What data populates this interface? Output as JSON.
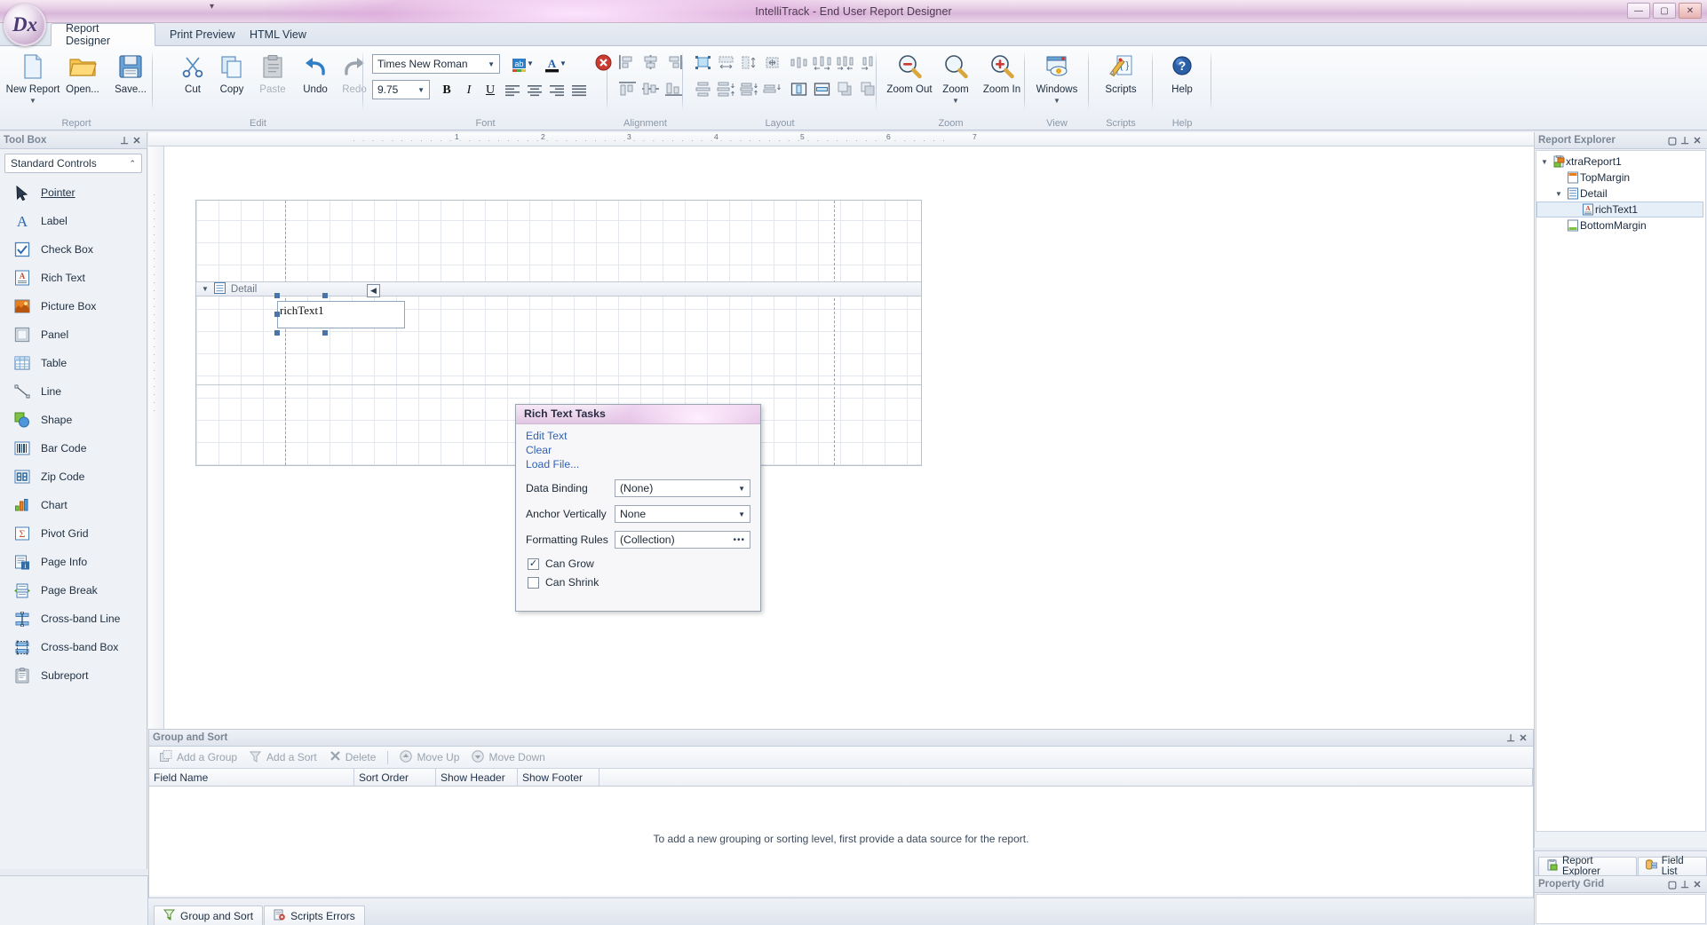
{
  "window": {
    "title": "IntelliTrack - End User Report Designer",
    "minimize_label": "—",
    "maximize_label": "▢",
    "close_label": "✕",
    "orb_label": "Dx",
    "quick_access_caret": "▾"
  },
  "ribbon": {
    "tabs": [
      {
        "label": "Report Designer",
        "active": true
      },
      {
        "label": "Print Preview",
        "active": false
      },
      {
        "label": "HTML View",
        "active": false
      }
    ],
    "groups": [
      {
        "label": "Report"
      },
      {
        "label": "Edit"
      },
      {
        "label": "Font"
      },
      {
        "label": "Alignment"
      },
      {
        "label": "Layout"
      },
      {
        "label": "Zoom"
      },
      {
        "label": "View"
      },
      {
        "label": "Scripts"
      },
      {
        "label": "Help"
      }
    ],
    "report_buttons": [
      {
        "label": "New Report",
        "icon": "new-document-icon",
        "has_dropdown": true,
        "disabled": false
      },
      {
        "label": "Open...",
        "icon": "open-folder-icon",
        "has_dropdown": false,
        "disabled": false
      },
      {
        "label": "Save...",
        "icon": "save-disk-icon",
        "has_dropdown": false,
        "disabled": false
      }
    ],
    "edit_buttons": [
      {
        "label": "Cut",
        "icon": "scissors-icon",
        "disabled": false
      },
      {
        "label": "Copy",
        "icon": "copy-icon",
        "disabled": false
      },
      {
        "label": "Paste",
        "icon": "clipboard-icon",
        "disabled": true
      },
      {
        "label": "Undo",
        "icon": "undo-arrow-icon",
        "disabled": false
      },
      {
        "label": "Redo",
        "icon": "redo-arrow-icon",
        "disabled": true
      }
    ],
    "font": {
      "family_value": "Times New Roman",
      "size_value": "9.75",
      "bold_label": "B",
      "italic_label": "I",
      "underline_label": "U",
      "highlight_icon": "text-highlight-icon",
      "fontcolor_icon": "font-color-icon",
      "align_left_icon": "align-left-icon",
      "align_center_icon": "align-center-icon",
      "align_right_icon": "align-right-icon",
      "align_justify_icon": "align-justify-icon"
    },
    "zoom_buttons": [
      {
        "label": "Zoom Out",
        "icon": "zoom-out-icon",
        "has_dropdown": false
      },
      {
        "label": "Zoom",
        "icon": "zoom-icon",
        "has_dropdown": true
      },
      {
        "label": "Zoom In",
        "icon": "zoom-in-icon",
        "has_dropdown": false
      }
    ],
    "view_buttons": [
      {
        "label": "Windows",
        "icon": "windows-icon",
        "has_dropdown": true
      }
    ],
    "scripts_buttons": [
      {
        "label": "Scripts",
        "icon": "scripts-pencil-icon",
        "has_dropdown": false
      }
    ],
    "help_buttons": [
      {
        "label": "Help",
        "icon": "help-question-icon",
        "has_dropdown": false
      }
    ]
  },
  "toolbox": {
    "title": "Tool Box",
    "pin_label": "⊥",
    "close_label": "✕",
    "category": "Standard Controls",
    "category_caret": "⌃",
    "items": [
      {
        "label": "Pointer",
        "icon": "pointer-arrow-icon",
        "selected": true
      },
      {
        "label": "Label",
        "icon": "label-a-icon",
        "selected": false
      },
      {
        "label": "Check Box",
        "icon": "check-box-icon",
        "selected": false
      },
      {
        "label": "Rich Text",
        "icon": "rich-text-icon",
        "selected": false
      },
      {
        "label": "Picture Box",
        "icon": "picture-box-icon",
        "selected": false
      },
      {
        "label": "Panel",
        "icon": "panel-icon",
        "selected": false
      },
      {
        "label": "Table",
        "icon": "table-icon",
        "selected": false
      },
      {
        "label": "Line",
        "icon": "line-icon",
        "selected": false
      },
      {
        "label": "Shape",
        "icon": "shape-icon",
        "selected": false
      },
      {
        "label": "Bar Code",
        "icon": "bar-code-icon",
        "selected": false
      },
      {
        "label": "Zip Code",
        "icon": "zip-code-icon",
        "selected": false
      },
      {
        "label": "Chart",
        "icon": "chart-icon",
        "selected": false
      },
      {
        "label": "Pivot Grid",
        "icon": "pivot-grid-icon",
        "selected": false
      },
      {
        "label": "Page Info",
        "icon": "page-info-icon",
        "selected": false
      },
      {
        "label": "Page Break",
        "icon": "page-break-icon",
        "selected": false
      },
      {
        "label": "Cross-band Line",
        "icon": "cross-band-line-icon",
        "selected": false
      },
      {
        "label": "Cross-band Box",
        "icon": "cross-band-box-icon",
        "selected": false
      },
      {
        "label": "Subreport",
        "icon": "subreport-icon",
        "selected": false
      }
    ]
  },
  "designer": {
    "ruler_ticks": [
      "1",
      "2",
      "3",
      "4",
      "5",
      "6",
      "7"
    ],
    "band_label": "Detail",
    "band_collapse_caret": "▼",
    "band_icon": "detail-band-icon",
    "control_text": "richText1",
    "smart_tag_glyph": "◀"
  },
  "tasks_panel": {
    "title": "Rich Text Tasks",
    "links": [
      "Edit Text",
      "Clear",
      "Load File..."
    ],
    "fields": [
      {
        "label": "Data Binding",
        "value": "(None)",
        "control": "dropdown"
      },
      {
        "label": "Anchor Vertically",
        "value": "None",
        "control": "dropdown"
      },
      {
        "label": "Formatting Rules",
        "value": "(Collection)",
        "control": "ellipsis"
      }
    ],
    "dropdown_glyph": "▼",
    "ellipsis_glyph": "•••",
    "checks": [
      {
        "label": "Can Grow",
        "checked": true
      },
      {
        "label": "Can Shrink",
        "checked": false
      }
    ],
    "check_glyph": "✓"
  },
  "group_and_sort": {
    "title": "Group and Sort",
    "pin_label": "⊥",
    "close_label": "✕",
    "toolbar": [
      {
        "label": "Add a Group",
        "icon": "add-group-icon"
      },
      {
        "label": "Add a Sort",
        "icon": "add-sort-icon"
      },
      {
        "label": "Delete",
        "icon": "delete-x-icon"
      },
      {
        "label": "Move Up",
        "icon": "move-up-icon"
      },
      {
        "label": "Move Down",
        "icon": "move-down-icon"
      }
    ],
    "columns": [
      "Field Name",
      "Sort Order",
      "Show Header",
      "Show Footer"
    ],
    "empty_message": "To add a new grouping or sorting level, first provide a data source for the report.",
    "tabs": [
      {
        "label": "Group and Sort",
        "icon": "group-sort-icon",
        "active": true
      },
      {
        "label": "Scripts Errors",
        "icon": "scripts-errors-icon",
        "active": false
      }
    ]
  },
  "report_explorer": {
    "title": "Report Explorer",
    "restore_label": "▢",
    "pin_label": "⊥",
    "close_label": "✕",
    "tree": [
      {
        "label": "xtraReport1",
        "icon": "report-icon",
        "depth": 0,
        "expander": "▼",
        "selected": false
      },
      {
        "label": "TopMargin",
        "icon": "top-margin-icon",
        "depth": 1,
        "expander": "",
        "selected": false
      },
      {
        "label": "Detail",
        "icon": "detail-band-icon",
        "depth": 1,
        "expander": "▼",
        "selected": false
      },
      {
        "label": "richText1",
        "icon": "rich-text-icon",
        "depth": 2,
        "expander": "",
        "selected": true
      },
      {
        "label": "BottomMargin",
        "icon": "bottom-margin-icon",
        "depth": 1,
        "expander": "",
        "selected": false
      }
    ],
    "tabs": [
      {
        "label": "Report Explorer",
        "icon": "report-explorer-icon",
        "active": true
      },
      {
        "label": "Field List",
        "icon": "field-list-icon",
        "active": false
      }
    ]
  },
  "property_grid": {
    "title": "Property Grid",
    "restore_label": "▢",
    "pin_label": "⊥",
    "close_label": "✕"
  }
}
